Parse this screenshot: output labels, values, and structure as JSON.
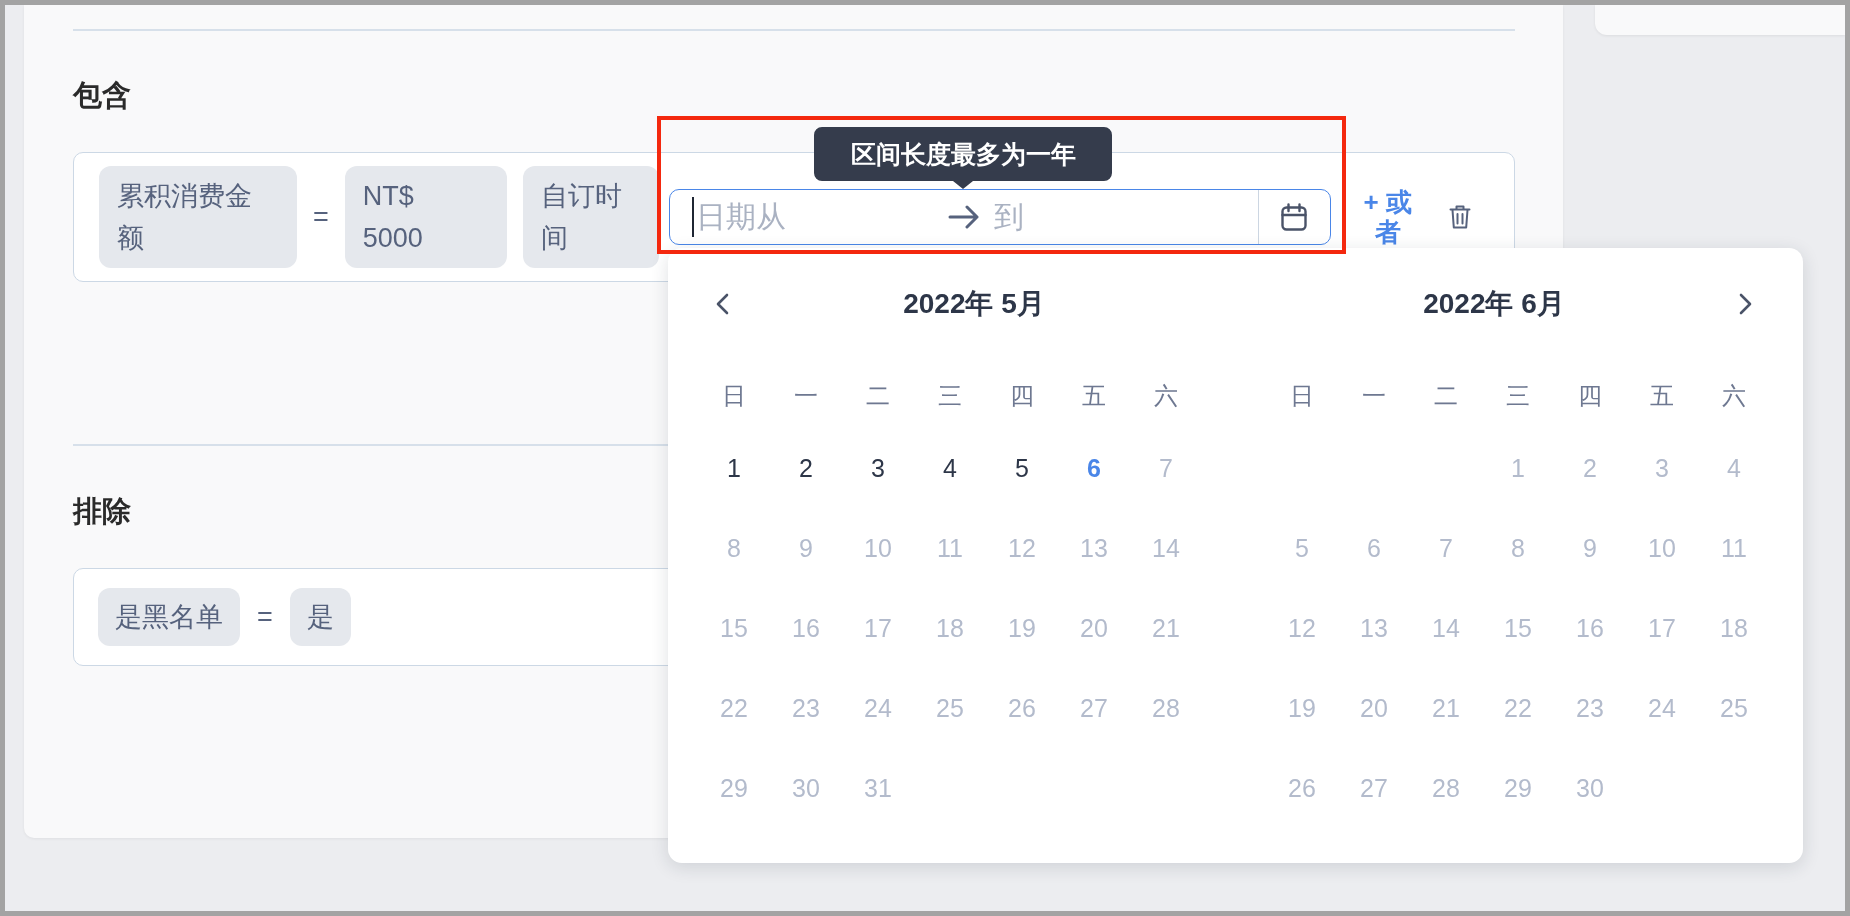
{
  "include": {
    "heading": "包含",
    "conditions": [
      {
        "kind": "chip",
        "text": "累积消费金额"
      },
      {
        "kind": "operator",
        "text": "="
      },
      {
        "kind": "chip",
        "text": "NT$ 5000"
      },
      {
        "kind": "chip",
        "text": "自订时间"
      }
    ],
    "date_range": {
      "tooltip": "区间长度最多为一年",
      "start": {
        "placeholder": "日期从",
        "focused": true
      },
      "end": {
        "placeholder": "到",
        "focused": false
      }
    },
    "or_link": "+ 或者"
  },
  "exclude": {
    "heading": "排除",
    "conditions": [
      {
        "kind": "chip",
        "text": "是黑名单"
      },
      {
        "kind": "operator",
        "text": "="
      },
      {
        "kind": "chip",
        "text": "是"
      }
    ]
  },
  "calendar": {
    "months": [
      {
        "title": "2022年 5月",
        "weekdays": [
          "日",
          "一",
          "二",
          "三",
          "四",
          "五",
          "六"
        ],
        "days": [
          {
            "kind": "day",
            "label": "1",
            "disabled": false,
            "today": false
          },
          {
            "kind": "day",
            "label": "2",
            "disabled": false,
            "today": false
          },
          {
            "kind": "day",
            "label": "3",
            "disabled": false,
            "today": false
          },
          {
            "kind": "day",
            "label": "4",
            "disabled": false,
            "today": false
          },
          {
            "kind": "day",
            "label": "5",
            "disabled": false,
            "today": false
          },
          {
            "kind": "day",
            "label": "6",
            "disabled": false,
            "today": true
          },
          {
            "kind": "day",
            "label": "7",
            "disabled": true,
            "today": false
          },
          {
            "kind": "day",
            "label": "8",
            "disabled": true,
            "today": false
          },
          {
            "kind": "day",
            "label": "9",
            "disabled": true,
            "today": false
          },
          {
            "kind": "day",
            "label": "10",
            "disabled": true,
            "today": false
          },
          {
            "kind": "day",
            "label": "11",
            "disabled": true,
            "today": false
          },
          {
            "kind": "day",
            "label": "12",
            "disabled": true,
            "today": false
          },
          {
            "kind": "day",
            "label": "13",
            "disabled": true,
            "today": false
          },
          {
            "kind": "day",
            "label": "14",
            "disabled": true,
            "today": false
          },
          {
            "kind": "day",
            "label": "15",
            "disabled": true,
            "today": false
          },
          {
            "kind": "day",
            "label": "16",
            "disabled": true,
            "today": false
          },
          {
            "kind": "day",
            "label": "17",
            "disabled": true,
            "today": false
          },
          {
            "kind": "day",
            "label": "18",
            "disabled": true,
            "today": false
          },
          {
            "kind": "day",
            "label": "19",
            "disabled": true,
            "today": false
          },
          {
            "kind": "day",
            "label": "20",
            "disabled": true,
            "today": false
          },
          {
            "kind": "day",
            "label": "21",
            "disabled": true,
            "today": false
          },
          {
            "kind": "day",
            "label": "22",
            "disabled": true,
            "today": false
          },
          {
            "kind": "day",
            "label": "23",
            "disabled": true,
            "today": false
          },
          {
            "kind": "day",
            "label": "24",
            "disabled": true,
            "today": false
          },
          {
            "kind": "day",
            "label": "25",
            "disabled": true,
            "today": false
          },
          {
            "kind": "day",
            "label": "26",
            "disabled": true,
            "today": false
          },
          {
            "kind": "day",
            "label": "27",
            "disabled": true,
            "today": false
          },
          {
            "kind": "day",
            "label": "28",
            "disabled": true,
            "today": false
          },
          {
            "kind": "day",
            "label": "29",
            "disabled": true,
            "today": false
          },
          {
            "kind": "day",
            "label": "30",
            "disabled": true,
            "today": false
          },
          {
            "kind": "day",
            "label": "31",
            "disabled": true,
            "today": false
          }
        ]
      },
      {
        "title": "2022年 6月",
        "weekdays": [
          "日",
          "一",
          "二",
          "三",
          "四",
          "五",
          "六"
        ],
        "days": [
          {
            "kind": "blank"
          },
          {
            "kind": "blank"
          },
          {
            "kind": "blank"
          },
          {
            "kind": "day",
            "label": "1",
            "disabled": true,
            "today": false
          },
          {
            "kind": "day",
            "label": "2",
            "disabled": true,
            "today": false
          },
          {
            "kind": "day",
            "label": "3",
            "disabled": true,
            "today": false
          },
          {
            "kind": "day",
            "label": "4",
            "disabled": true,
            "today": false
          },
          {
            "kind": "day",
            "label": "5",
            "disabled": true,
            "today": false
          },
          {
            "kind": "day",
            "label": "6",
            "disabled": true,
            "today": false
          },
          {
            "kind": "day",
            "label": "7",
            "disabled": true,
            "today": false
          },
          {
            "kind": "day",
            "label": "8",
            "disabled": true,
            "today": false
          },
          {
            "kind": "day",
            "label": "9",
            "disabled": true,
            "today": false
          },
          {
            "kind": "day",
            "label": "10",
            "disabled": true,
            "today": false
          },
          {
            "kind": "day",
            "label": "11",
            "disabled": true,
            "today": false
          },
          {
            "kind": "day",
            "label": "12",
            "disabled": true,
            "today": false
          },
          {
            "kind": "day",
            "label": "13",
            "disabled": true,
            "today": false
          },
          {
            "kind": "day",
            "label": "14",
            "disabled": true,
            "today": false
          },
          {
            "kind": "day",
            "label": "15",
            "disabled": true,
            "today": false
          },
          {
            "kind": "day",
            "label": "16",
            "disabled": true,
            "today": false
          },
          {
            "kind": "day",
            "label": "17",
            "disabled": true,
            "today": false
          },
          {
            "kind": "day",
            "label": "18",
            "disabled": true,
            "today": false
          },
          {
            "kind": "day",
            "label": "19",
            "disabled": true,
            "today": false
          },
          {
            "kind": "day",
            "label": "20",
            "disabled": true,
            "today": false
          },
          {
            "kind": "day",
            "label": "21",
            "disabled": true,
            "today": false
          },
          {
            "kind": "day",
            "label": "22",
            "disabled": true,
            "today": false
          },
          {
            "kind": "day",
            "label": "23",
            "disabled": true,
            "today": false
          },
          {
            "kind": "day",
            "label": "24",
            "disabled": true,
            "today": false
          },
          {
            "kind": "day",
            "label": "25",
            "disabled": true,
            "today": false
          },
          {
            "kind": "day",
            "label": "26",
            "disabled": true,
            "today": false
          },
          {
            "kind": "day",
            "label": "27",
            "disabled": true,
            "today": false
          },
          {
            "kind": "day",
            "label": "28",
            "disabled": true,
            "today": false
          },
          {
            "kind": "day",
            "label": "29",
            "disabled": true,
            "today": false
          },
          {
            "kind": "day",
            "label": "30",
            "disabled": true,
            "today": false
          }
        ]
      }
    ]
  }
}
